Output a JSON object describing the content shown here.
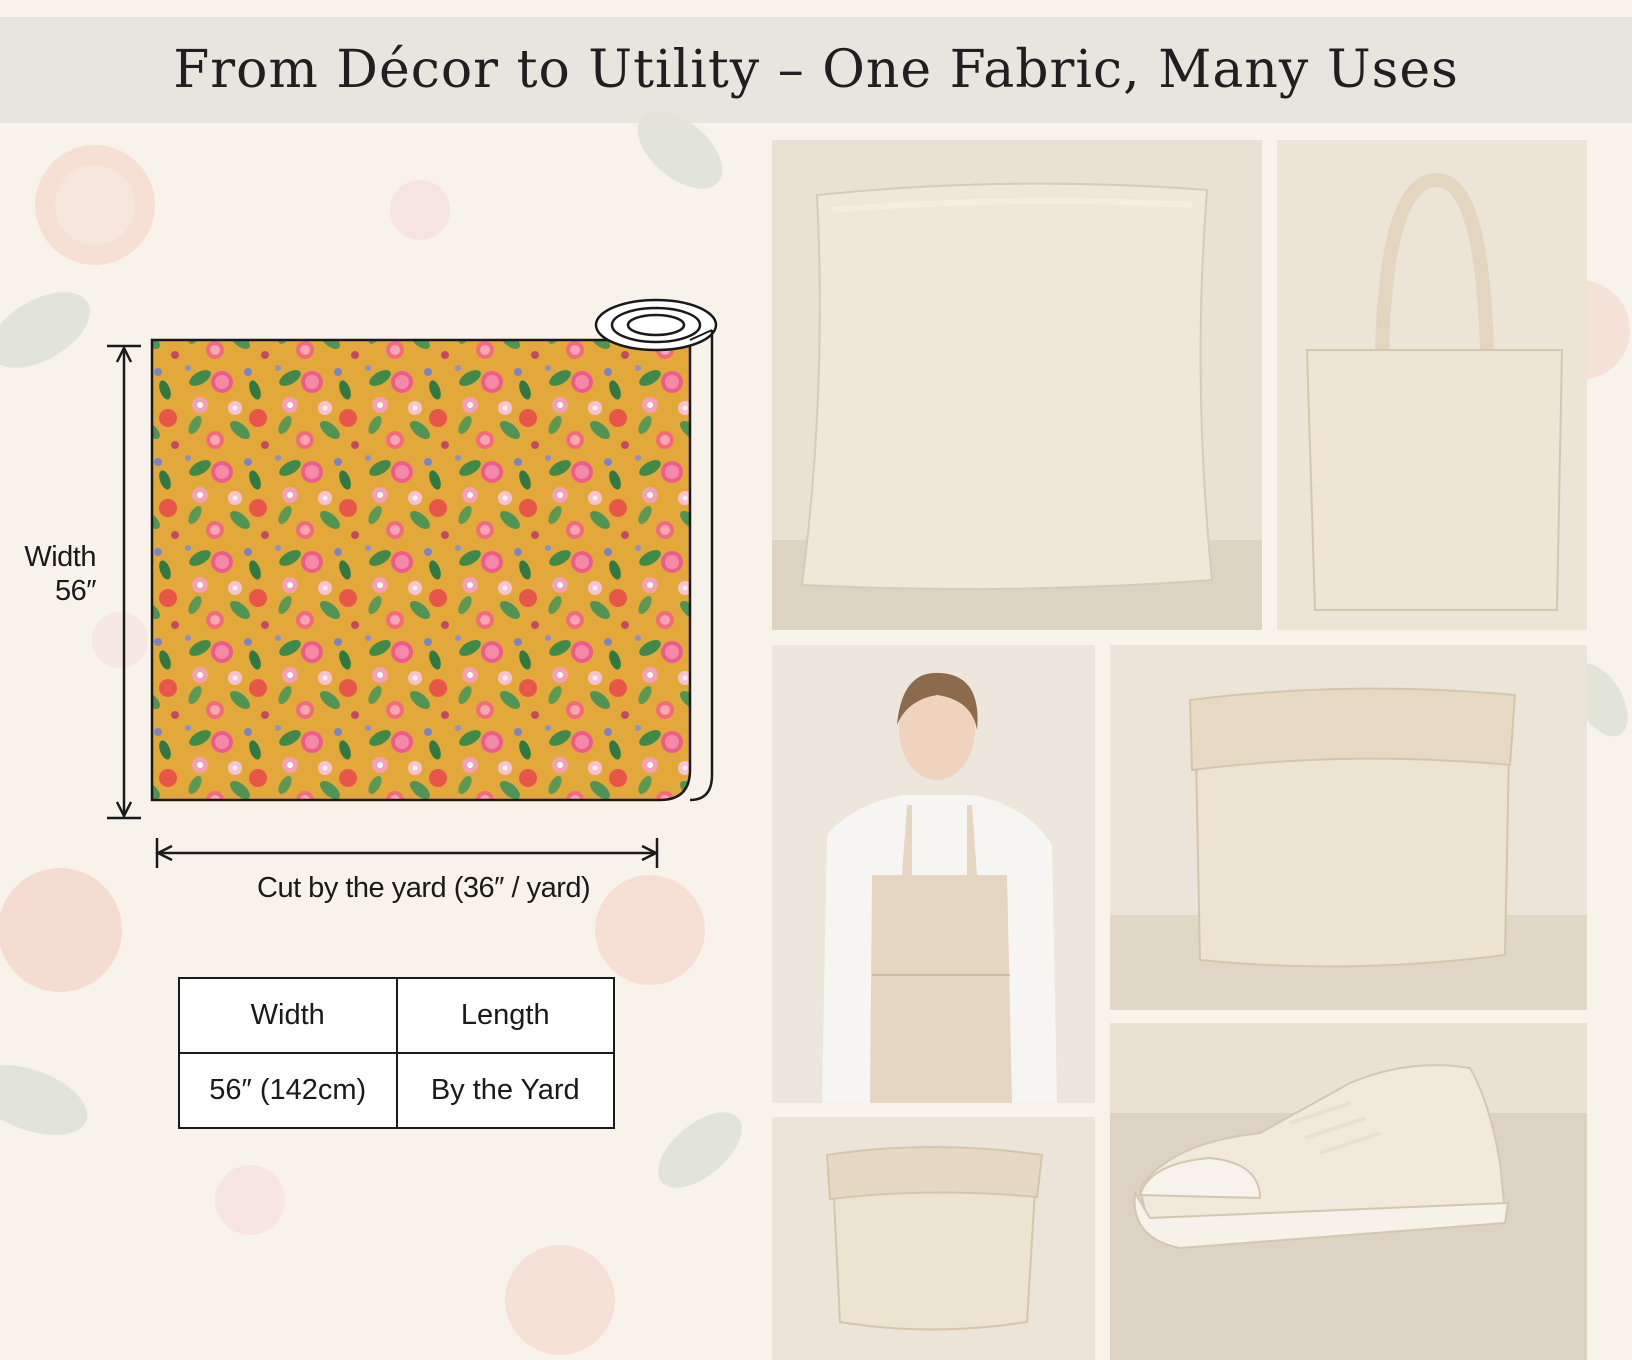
{
  "title": "From Décor to Utility – One Fabric, Many Uses",
  "diagram": {
    "width_label_line1": "Width",
    "width_label_line2": "56″",
    "cut_label": "Cut by the yard (36″ / yard)"
  },
  "spec_table": {
    "headers": [
      "Width",
      "Length"
    ],
    "values": [
      "56″ (142cm)",
      "By the Yard"
    ]
  },
  "colors": {
    "fabric_background": "#e2a93a",
    "canvas_product": "#ece4d4",
    "accent_pink": "#ee5c8c",
    "title_band": "#e4e2dc"
  },
  "product_photos": [
    "pillow-photo",
    "tote-bag-photo",
    "apron-photo",
    "fabric-basket-photo",
    "small-basket-photo",
    "sneaker-photo"
  ]
}
